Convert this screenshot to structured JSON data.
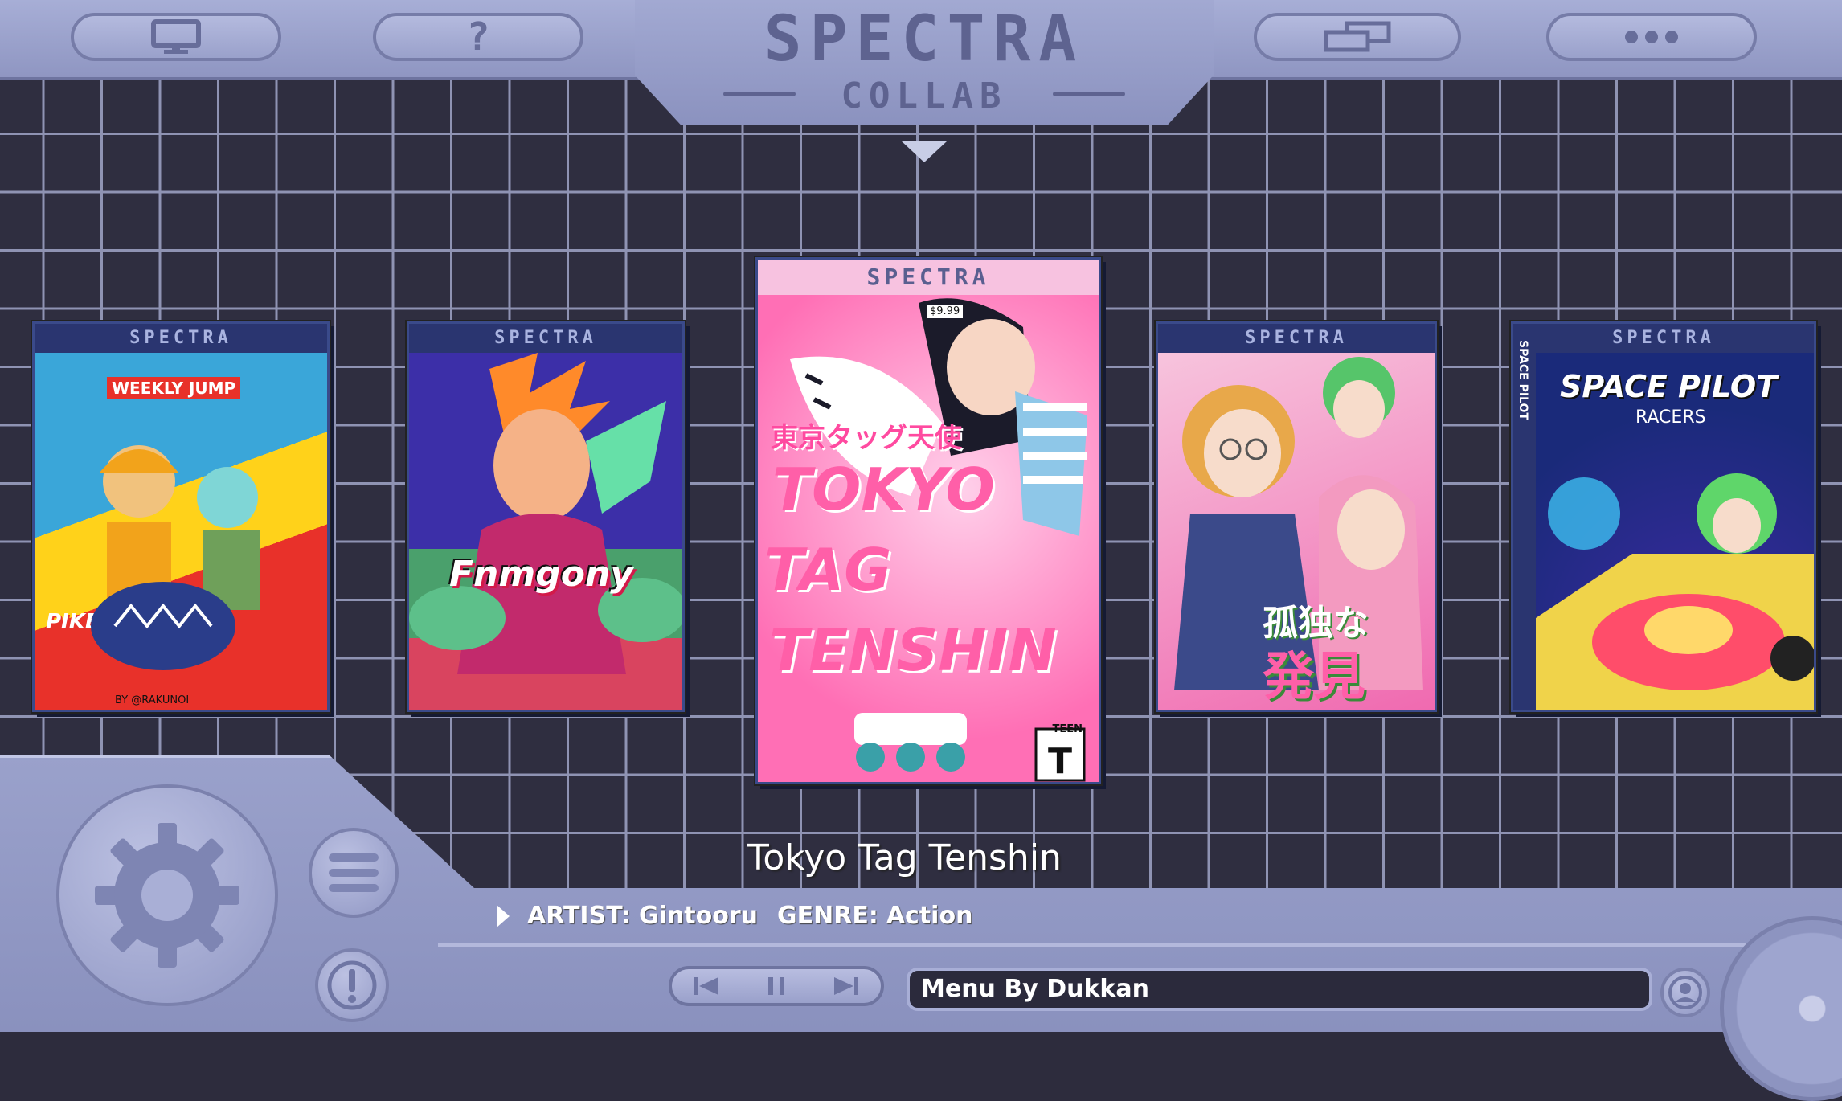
{
  "header": {
    "logo_title": "SPECTRA",
    "logo_subtitle": "COLLAB",
    "buttons": [
      {
        "name": "monitor-button",
        "icon": "monitor-icon"
      },
      {
        "name": "help-button",
        "icon": "question-icon"
      },
      {
        "name": "windows-button",
        "icon": "windows-icon"
      },
      {
        "name": "more-button",
        "icon": "more-dots-icon"
      }
    ]
  },
  "carousel": {
    "covers": [
      {
        "brand": "SPECTRA",
        "art_text": "WEEKLY JUMP",
        "art_text_2": "PIKEN PIKEN!",
        "art_text_3": "BY @RAKUNOI",
        "colors": [
          "#e8312a",
          "#ffd21a",
          "#3aa6d9"
        ]
      },
      {
        "brand": "SPECTRA",
        "art_text": "Fnmgony",
        "colors": [
          "#3c2fa8",
          "#e34a7a",
          "#66e0a8"
        ]
      },
      {
        "brand": "SPECTRA",
        "art_text": "TOKYO",
        "art_text_2": "TAG",
        "art_text_3": "TENSHIN",
        "jp_text": "東京タッグ天使",
        "price": "$9.99",
        "rating": "TEEN",
        "colors": [
          "#ff6fb5",
          "#ffd0ea",
          "#1b1b2a"
        ]
      },
      {
        "brand": "SPECTRA",
        "art_text": "孤独な",
        "art_text_2": "発見",
        "colors": [
          "#f06ab0",
          "#f7c4dd",
          "#56c56a"
        ]
      },
      {
        "brand": "SPECTRA",
        "art_text": "SPACE PILOT",
        "art_text_2": "RACERS",
        "side_text": "SPACE PILOT",
        "colors": [
          "#1a2a7a",
          "#40d3ff",
          "#ff4d6a"
        ]
      }
    ]
  },
  "selected_game": {
    "title": "Tokyo Tag Tenshin",
    "artist_label": "ARTIST:",
    "artist": "Gintooru",
    "genre_label": "GENRE:",
    "genre": "Action"
  },
  "footer": {
    "ticker": "Menu By Dukkan"
  },
  "theme": {
    "panel": "#9aa1cb",
    "grid_line": "#8f93b3",
    "background": "#2f2e40",
    "accent_text": "#ffffff"
  }
}
